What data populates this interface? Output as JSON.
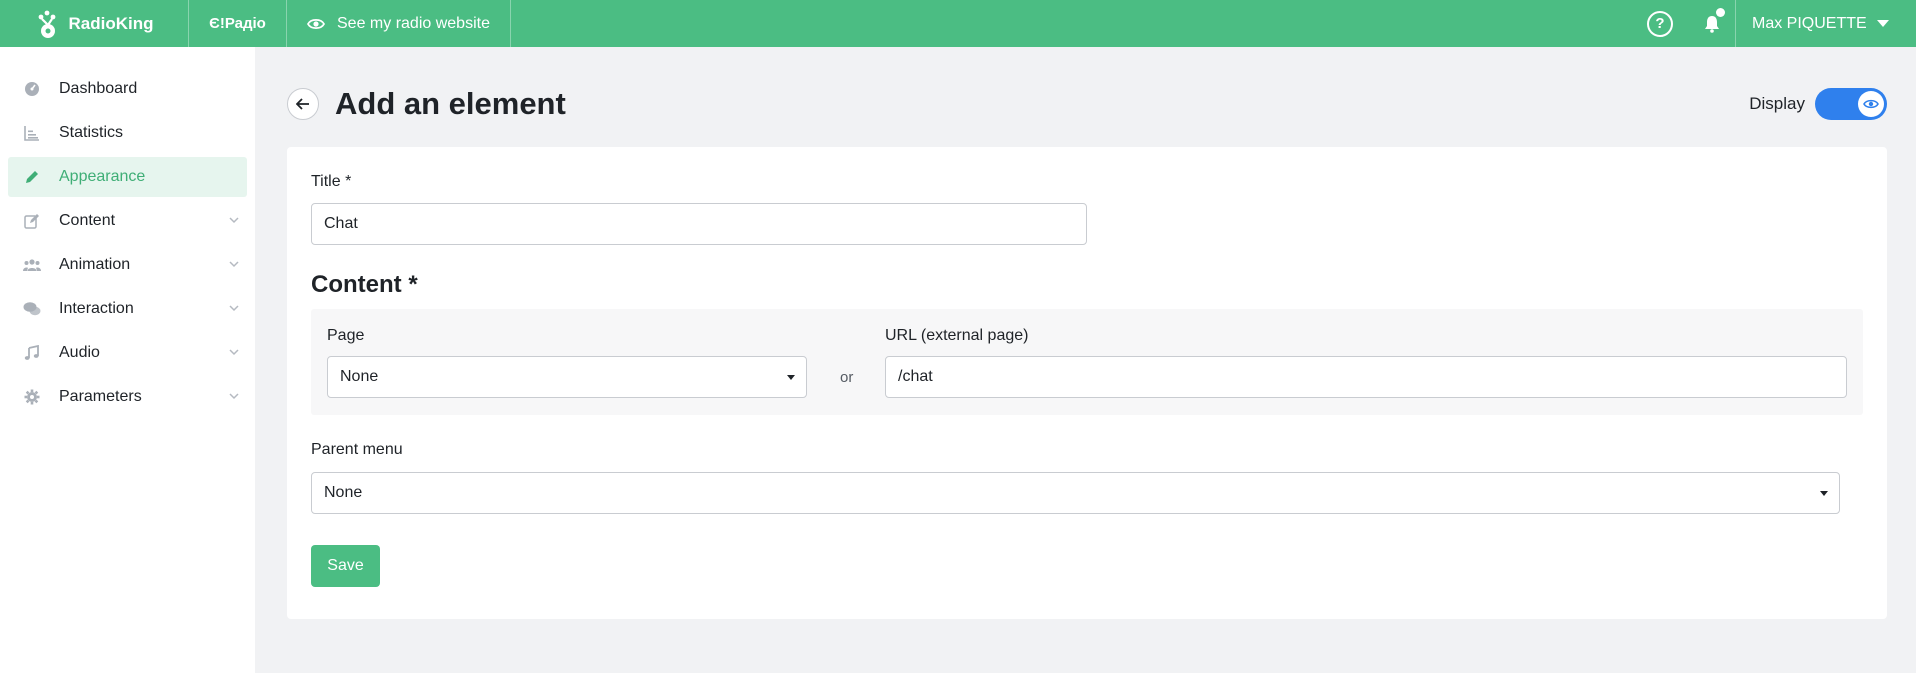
{
  "topbar": {
    "brand": "RadioKing",
    "radio_name": "Є!Радіо",
    "site_link": "See my radio website",
    "help_icon": "question-circle-icon",
    "bell_icon": "bell-icon",
    "user_name": "Max PIQUETTE"
  },
  "sidebar": {
    "items": [
      {
        "label": "Dashboard",
        "icon": "gauge-icon"
      },
      {
        "label": "Statistics",
        "icon": "bar-chart-icon"
      },
      {
        "label": "Appearance",
        "icon": "pencil-icon",
        "active": true
      },
      {
        "label": "Content",
        "icon": "edit-icon"
      },
      {
        "label": "Animation",
        "icon": "users-icon"
      },
      {
        "label": "Interaction",
        "icon": "chat-bubbles-icon"
      },
      {
        "label": "Audio",
        "icon": "music-note-icon"
      },
      {
        "label": "Parameters",
        "icon": "gear-icon"
      }
    ]
  },
  "main": {
    "title": "Add an element",
    "display_label": "Display",
    "display_on": true
  },
  "form": {
    "title_label": "Title *",
    "title_value": "Chat",
    "content_heading": "Content *",
    "page_label": "Page",
    "page_value": "None",
    "or_text": "or",
    "url_label": "URL (external page)",
    "url_value": "/chat",
    "parent_label": "Parent menu",
    "parent_value": "None",
    "save_label": "Save"
  },
  "colors": {
    "brand_green": "#4bbd83",
    "accent_blue": "#2f80ed",
    "active_bg": "#e6f5ee"
  }
}
